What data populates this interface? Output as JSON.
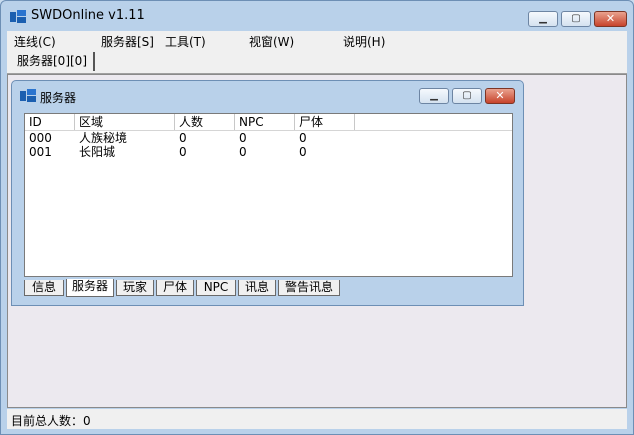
{
  "window": {
    "title": "SWDOnline v1.11",
    "icon": "app-logo-icon",
    "controls": {
      "minimize": "minimize-icon",
      "maximize": "maximize-icon",
      "close": "close-icon"
    }
  },
  "menu": {
    "items": [
      "连线(C)",
      "服务器[S]",
      "工具(T)",
      "视窗(W)",
      "说明(H)"
    ]
  },
  "top_tab": {
    "label": "服务器[0][0]"
  },
  "child_window": {
    "title": "服务器",
    "columns": [
      "ID",
      "区域",
      "人数",
      "NPC",
      "尸体"
    ],
    "rows": [
      [
        "000",
        "人族秘境",
        "0",
        "0",
        "0"
      ],
      [
        "001",
        "长阳城",
        "0",
        "0",
        "0"
      ]
    ],
    "tabs": [
      "信息",
      "服务器",
      "玩家",
      "尸体",
      "NPC",
      "讯息",
      "警告讯息"
    ],
    "active_tab": "服务器"
  },
  "status": {
    "text": "目前总人数：0"
  },
  "colors": {
    "title_bar": "#b9d1ea",
    "close_button": "#c7432b",
    "client_bg": "#ece9ef"
  }
}
